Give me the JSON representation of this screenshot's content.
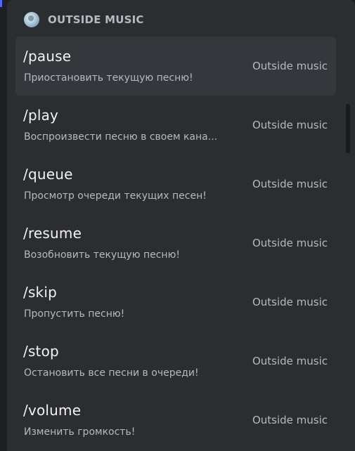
{
  "header": {
    "title": "OUTSIDE MUSIC",
    "avatar_icon": "bot-avatar-icon"
  },
  "commands": [
    {
      "name": "/pause",
      "description": "Приостановить текущую песню!",
      "source": "Outside music",
      "selected": true
    },
    {
      "name": "/play",
      "description": "Воспроизвести песню в своем кана...",
      "source": "Outside music",
      "selected": false
    },
    {
      "name": "/queue",
      "description": "Просмотр очереди текущих песен!",
      "source": "Outside music",
      "selected": false
    },
    {
      "name": "/resume",
      "description": "Возобновить текущую песню!",
      "source": "Outside music",
      "selected": false
    },
    {
      "name": "/skip",
      "description": "Пропустить песню!",
      "source": "Outside music",
      "selected": false
    },
    {
      "name": "/stop",
      "description": "Остановить все песни в очереди!",
      "source": "Outside music",
      "selected": false
    },
    {
      "name": "/volume",
      "description": "Изменить громкость!",
      "source": "Outside music",
      "selected": false
    }
  ],
  "colors": {
    "panel_bg": "#2b2d31",
    "selected_bg": "#35373c",
    "primary_text": "#f2f3f5",
    "secondary_text": "#b5bac1",
    "accent": "#5865f2"
  }
}
